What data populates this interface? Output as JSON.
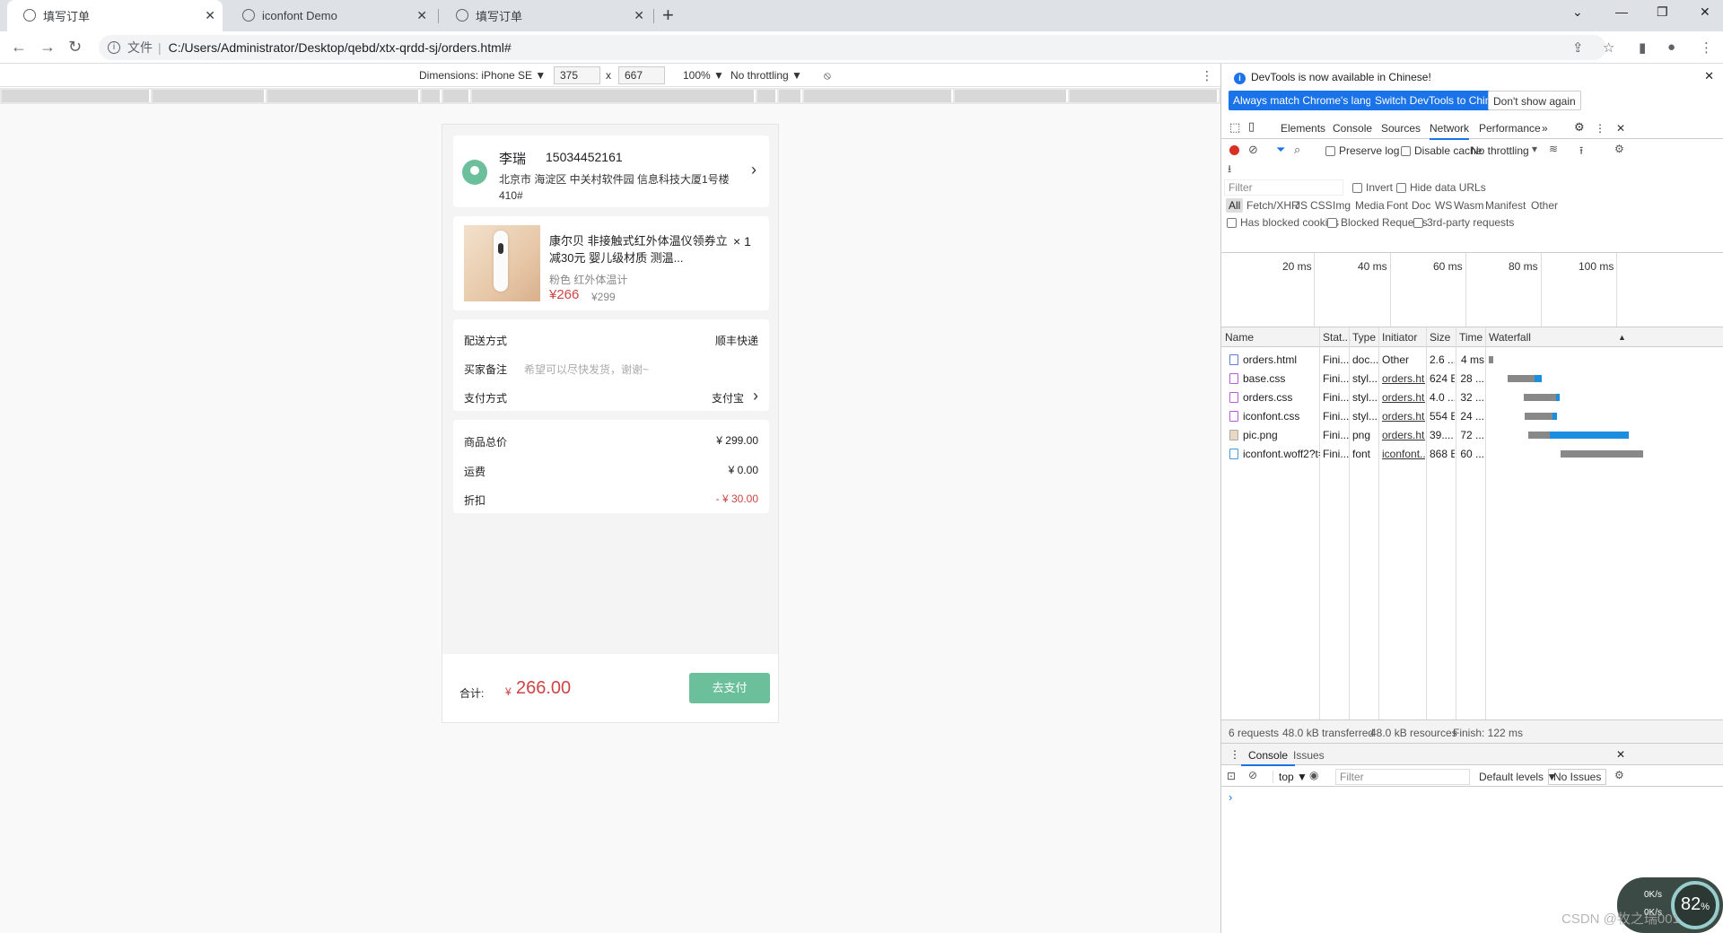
{
  "browser": {
    "tabs": [
      {
        "title": "填写订单",
        "active": true
      },
      {
        "title": "iconfont Demo",
        "active": false
      },
      {
        "title": "填写订单",
        "active": false
      }
    ],
    "address": {
      "scheme_label": "文件",
      "url": "C:/Users/Administrator/Desktop/qebd/xtx-qrdd-sj/orders.html#"
    }
  },
  "device_toolbar": {
    "dimensions_label": "Dimensions: iPhone SE ▼",
    "width": "375",
    "times": "x",
    "height": "667",
    "zoom": "100% ▼",
    "throttling": "No throttling ▼"
  },
  "order": {
    "address": {
      "name": "李瑞",
      "phone": "15034452161",
      "detail": "北京市 海淀区 中关村软件园 信息科技大厦1号楼410#"
    },
    "product": {
      "title": "康尔贝 非接触式红外体温仪领券立减30元 婴儿级材质 测温...",
      "qty": "× 1",
      "spec": "粉色    红外体温计",
      "price": "¥266",
      "old_price": "¥299"
    },
    "options": [
      {
        "label": "配送方式",
        "value": "顺丰快递"
      },
      {
        "label": "买家备注",
        "placeholder": "希望可以尽快发货，谢谢~"
      },
      {
        "label": "支付方式",
        "value": "支付宝"
      }
    ],
    "summary": [
      {
        "label": "商品总价",
        "value": "¥ 299.00"
      },
      {
        "label": "运费",
        "value": "¥ 0.00"
      },
      {
        "label": "折扣",
        "value": "- ¥ 30.00"
      }
    ],
    "footer": {
      "total_label": "合计:",
      "currency": "¥",
      "total": "266.00",
      "pay_button": "去支付"
    }
  },
  "devtools": {
    "banner": {
      "message": "DevTools is now available in Chinese!",
      "btn_match": "Always match Chrome's language",
      "btn_switch": "Switch DevTools to Chinese",
      "btn_dont": "Don't show again"
    },
    "tabs": [
      "Elements",
      "Console",
      "Sources",
      "Network",
      "Performance"
    ],
    "selected_tab": "Network",
    "network_toolbar": {
      "preserve_log": "Preserve log",
      "disable_cache": "Disable cache",
      "throttle": "No throttling"
    },
    "filter": {
      "placeholder": "Filter",
      "invert": "Invert",
      "hide_data_urls": "Hide data URLs",
      "types": [
        "All",
        "Fetch/XHR",
        "JS",
        "CSS",
        "Img",
        "Media",
        "Font",
        "Doc",
        "WS",
        "Wasm",
        "Manifest",
        "Other"
      ],
      "has_blocked_cookies": "Has blocked cookies",
      "blocked_requests": "Blocked Requests",
      "third_party": "3rd-party requests"
    },
    "timeline_marks": [
      "20 ms",
      "40 ms",
      "60 ms",
      "80 ms",
      "100 ms"
    ],
    "columns": [
      "Name",
      "Stat...",
      "Type",
      "Initiator",
      "Size",
      "Time",
      "Waterfall"
    ],
    "requests": [
      {
        "name": "orders.html",
        "status": "Fini...",
        "type": "doc...",
        "initiator": "Other",
        "size": "2.6 ...",
        "time": "4 ms",
        "kind": "doc"
      },
      {
        "name": "base.css",
        "status": "Fini...",
        "type": "styl...",
        "initiator": "orders.ht...",
        "size": "624 B",
        "time": "28 ...",
        "kind": "css"
      },
      {
        "name": "orders.css",
        "status": "Fini...",
        "type": "styl...",
        "initiator": "orders.ht...",
        "size": "4.0 ...",
        "time": "32 ...",
        "kind": "css"
      },
      {
        "name": "iconfont.css",
        "status": "Fini...",
        "type": "styl...",
        "initiator": "orders.ht...",
        "size": "554 B",
        "time": "24 ...",
        "kind": "css"
      },
      {
        "name": "pic.png",
        "status": "Fini...",
        "type": "png",
        "initiator": "orders.ht...",
        "size": "39....",
        "time": "72 ...",
        "kind": "png"
      },
      {
        "name": "iconfont.woff2?t=...",
        "status": "Fini...",
        "type": "font",
        "initiator": "iconfont....",
        "size": "868 B",
        "time": "60 ...",
        "kind": "font"
      }
    ],
    "status_bar": {
      "requests": "6 requests",
      "transferred": "48.0 kB transferred",
      "resources": "48.0 kB resources",
      "finish": "Finish: 122 ms"
    },
    "drawer": {
      "tabs": [
        "Console",
        "Issues"
      ],
      "context": "top ▼",
      "filter_placeholder": "Filter",
      "levels": "Default levels ▼",
      "issues": "No Issues",
      "prompt": "›"
    }
  },
  "overlay": {
    "speed_percent": "82",
    "speed_unit": "%",
    "rate_up": "0K/s",
    "rate_down": "0K/s",
    "watermark": "CSDN @牧之瑞001"
  }
}
